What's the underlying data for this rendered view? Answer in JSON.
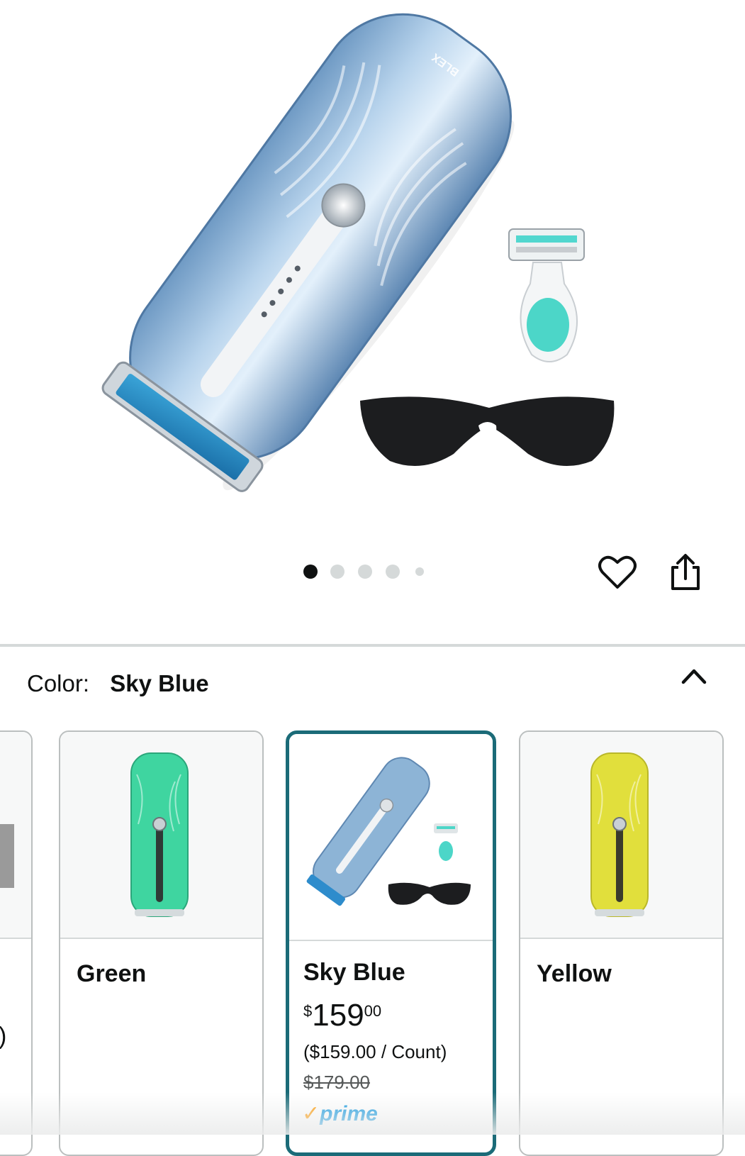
{
  "hero": {
    "brand_mark": "BLEX",
    "carousel": {
      "total": 5,
      "active_index": 0
    }
  },
  "actions": {
    "wishlist_icon": "heart-icon",
    "share_icon": "share-icon"
  },
  "color_selector": {
    "label": "Color:",
    "selected_value": "Sky Blue",
    "toggle_icon": "chevron-up-icon"
  },
  "swatches": [
    {
      "name": "",
      "partial": true,
      "trailing_text": ")"
    },
    {
      "name": "Green",
      "device_color": "#3fd5a0"
    },
    {
      "name": "Sky Blue",
      "selected": true,
      "device_color": "#8db4d6",
      "price": {
        "symbol": "$",
        "whole": "159",
        "fraction": "00"
      },
      "unit_price": "($159.00 / Count)",
      "list_price": "$179.00",
      "prime": {
        "check": "✓",
        "label": "prime"
      }
    },
    {
      "name": "Yellow",
      "device_color": "#e1df3c"
    }
  ],
  "colors": {
    "selected_border": "#1b6b78",
    "prime_blue": "#1399e0",
    "prime_check": "#ff9900"
  }
}
